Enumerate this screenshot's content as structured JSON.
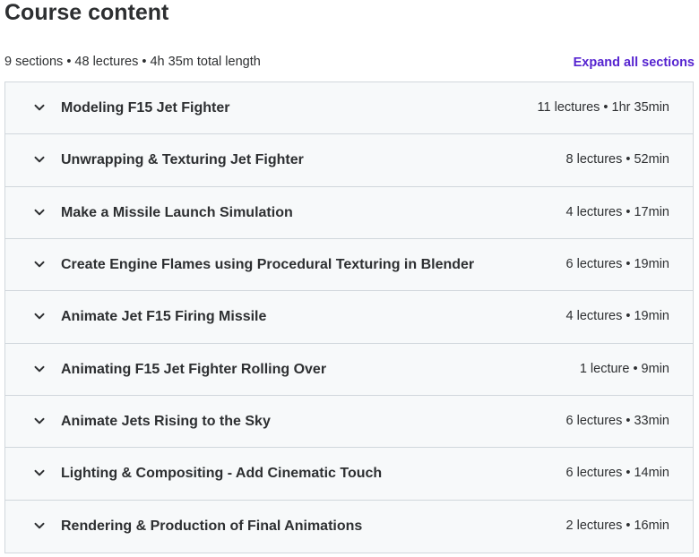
{
  "header": {
    "title": "Course content",
    "summary": "9 sections • 48 lectures • 4h 35m total length",
    "expand_all_label": "Expand all sections"
  },
  "colors": {
    "accent": "#5624d0",
    "section_bg": "#f7f9fa",
    "border": "#d1d7dc",
    "text": "#2d2f31"
  },
  "icons": {
    "section_toggle": "chevron-down-icon"
  },
  "sections": [
    {
      "title": "Modeling F15 Jet Fighter",
      "meta": "11 lectures • 1hr 35min"
    },
    {
      "title": "Unwrapping & Texturing Jet Fighter",
      "meta": "8 lectures • 52min"
    },
    {
      "title": "Make a Missile Launch Simulation",
      "meta": "4 lectures • 17min"
    },
    {
      "title": "Create Engine Flames using Procedural Texturing in Blender",
      "meta": "6 lectures • 19min"
    },
    {
      "title": "Animate Jet F15 Firing Missile",
      "meta": "4 lectures • 19min"
    },
    {
      "title": "Animating F15 Jet Fighter Rolling Over",
      "meta": "1 lecture • 9min"
    },
    {
      "title": "Animate Jets Rising to the Sky",
      "meta": "6 lectures • 33min"
    },
    {
      "title": "Lighting & Compositing - Add Cinematic Touch",
      "meta": "6 lectures • 14min"
    },
    {
      "title": "Rendering & Production of Final Animations",
      "meta": "2 lectures • 16min"
    }
  ]
}
